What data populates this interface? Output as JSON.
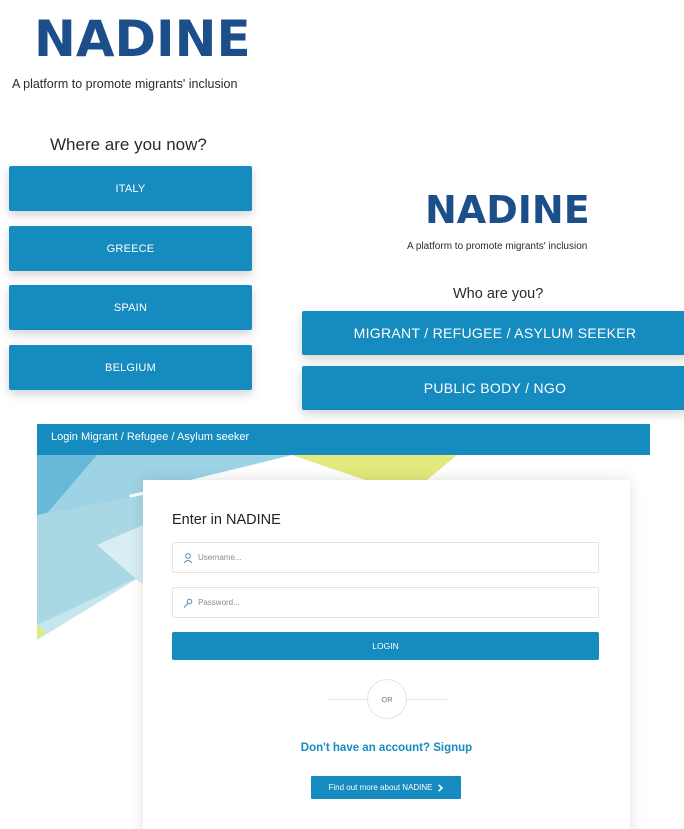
{
  "panel1": {
    "logo_text": "NADINE",
    "tagline": "A platform to promote migrants' inclusion",
    "question": "Where are you now?",
    "countries": [
      {
        "label": "ITALY"
      },
      {
        "label": "GREECE"
      },
      {
        "label": "SPAIN"
      },
      {
        "label": "BELGIUM"
      }
    ]
  },
  "panel2": {
    "logo_text": "NADINE",
    "tagline": "A platform to promote migrants' inclusion",
    "question": "Who are you?",
    "options": [
      {
        "label": "MIGRANT / REFUGEE / ASYLUM SEEKER"
      },
      {
        "label": "PUBLIC BODY / NGO"
      }
    ]
  },
  "panel3": {
    "header_title": "Login Migrant / Refugee / Asylum seeker",
    "card_title": "Enter in NADINE",
    "username_placeholder": "Username...",
    "password_placeholder": "Password...",
    "login_label": "LOGIN",
    "or_label": "OR",
    "signup_text": "Don't have an account? Signup",
    "more_label": "Find out more about NADINE",
    "more_icon": "chevron-right-icon"
  },
  "colors": {
    "primary": "#168bbf",
    "logo_dark": "#1c4f8a",
    "logo_accent": "#25a4d6",
    "bg_light_blue": "#a9d8e4",
    "bg_yellow": "#e3ea7d"
  }
}
